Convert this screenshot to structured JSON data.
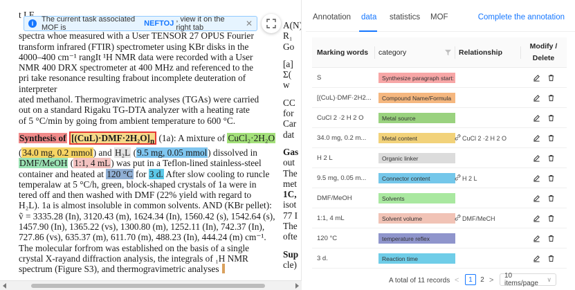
{
  "document": {
    "top_fragment": "t                                                         I F",
    "lines": [
      "spectra whoe measured with a User TENSOR 27 OPUS Fourier",
      "transform infrared (FTIR) spectrometer using KBr disks in the",
      "4000–400 cm⁻¹ rangIt ¹H NMR data were recorded with a User",
      "NMR 400 DRX spectrometer at 400 MHz and referenced to the",
      "pri take resonance resulting frabout incomplete deuteration of interpreter",
      "ated methanol. Thermogravimetric analyses (TGAs) were carried",
      "out on a standard Rigaku TG-DTA analyzer with a heating rate",
      "of 5 °C/min by going from ambient temperature to 600 °C."
    ],
    "synthesis": {
      "label": "Synthesis of",
      "compound": "[(CuL)·DMF·2H₂O]",
      "compound_suffix": "n",
      "ref": " (1a): A mixture of ",
      "metal_source": "CuCl₂·2H₂O",
      "l2_open": "(",
      "metal_mass": "34.0 mg, 0.2 mmol",
      "l2_mid": ") and ",
      "linker": "H₂L",
      "l2_space": " (",
      "linker_amount": "9.5 mg, 0.05 mmol",
      "l2_end": ") dissolved in",
      "solvent": "DMF/MeOH",
      "l3_open": " (",
      "solvent_volume": "1:1, 4 mL",
      "l3_end": ") was put in a Teflon-lined stainless-steel",
      "l4_start": "container and heated at ",
      "temperature": "120 °C",
      "l4_mid": " for ",
      "time": "3 d.",
      "l4_end": " After slow cooling to runcle",
      "rest": [
        "temperalaw at 5 °C/h, green, block-shaped crystals of 1a were in",
        "tered off and then washed with DMF (22% yield with regard to",
        "H₂L). 1a is almost insoluble in common solvents. AND (KBr pellet):",
        "ṽ = 3335.28 (In), 3120.43 (m), 1624.34 (In), 1560.42 (s), 1542.64 (s),",
        "1457.90 (In), 1365.22 (vs), 1300.80 (m), 1252.11 (In), 742.37 (In),",
        "727.86 (vs), 635.37 (m), 611.70 (m), 488.23 (In), 444.24 (m) cm⁻¹.",
        "The molecular forfrom was established on the basis of a single",
        "crystal X-rayand diffraction analysis, the integrals of ₁H NMR",
        "spectrum (Figure S3), and thermogravimetric analyses"
      ]
    },
    "side_column": [
      "A(N)",
      "R₁",
      "Go",
      "",
      "[a]",
      "Σ(",
      "w",
      "",
      "CC",
      "for",
      "Car",
      "dat",
      "",
      "Gas",
      "out",
      "The",
      "met",
      "1C,",
      "isot",
      "77 I",
      "The",
      "ofte",
      "",
      "Sup",
      "cle)"
    ]
  },
  "banner": {
    "prefix": "The current task associated MOF is",
    "mof_name": "NEFTOJ",
    "suffix": ", view it on the right tab",
    "close": "✕"
  },
  "panel": {
    "tabs": [
      {
        "label": "Annotation",
        "active": false
      },
      {
        "label": "data",
        "active": true
      },
      {
        "label": "statistics",
        "active": false
      },
      {
        "label": "MOF",
        "active": false
      }
    ],
    "complete_label": "Complete the annotation",
    "columns": {
      "marking_words": "Marking words",
      "category": "category",
      "relationship": "Relationship",
      "modify": "Modify /",
      "delete": "Delete"
    },
    "rows": [
      {
        "word": "S",
        "category": "Synthesize paragraph start: d",
        "color": "#f7a6a6",
        "relationship": ""
      },
      {
        "word": "[(CuL)·DMF·2H2...",
        "category": "Compound Name/Formula",
        "color": "#f5b77f",
        "relationship": ""
      },
      {
        "word": "CuCl 2 ·2 H 2 O",
        "category": "Metal source",
        "color": "#9ad27f",
        "relationship": ""
      },
      {
        "word": "34.0 mg, 0.2 m...",
        "category": "Metal content",
        "color": "#f2d27a",
        "relationship": "CuCl 2 ·2 H 2 O"
      },
      {
        "word": "H 2 L",
        "category": "Organic linker",
        "color": "#dcdcdc",
        "relationship": ""
      },
      {
        "word": "9.5 mg, 0.05 m...",
        "category": "Connector content",
        "color": "#74c7ea",
        "relationship": "H 2 L"
      },
      {
        "word": "DMF/MeOH",
        "category": "Solvents",
        "color": "#a9e8a0",
        "relationship": ""
      },
      {
        "word": "1:1, 4 mL",
        "category": "Solvent volume",
        "color": "#f1c3b6",
        "relationship": "DMF/MeCH"
      },
      {
        "word": "120 °C",
        "category": "temperature reflex",
        "color": "#8f95cc",
        "relationship": ""
      },
      {
        "word": "3 d.",
        "category": "Reaction time",
        "color": "#6fcde8",
        "relationship": ""
      }
    ],
    "pagination": {
      "total": "A total of 11 records",
      "prev": "<",
      "pages": [
        "1",
        "2"
      ],
      "current": "1",
      "next": ">",
      "page_size": "10 items/page",
      "page_size_arrow": "∨"
    }
  },
  "icons": {
    "info": "info-icon",
    "fab": "expand-icon",
    "filter": "filter-icon",
    "edit": "edit-icon",
    "delete": "trash-icon",
    "link": "link-icon"
  },
  "colors": {
    "accent": "#1677ff",
    "banner_bg": "#e6f4ff"
  }
}
